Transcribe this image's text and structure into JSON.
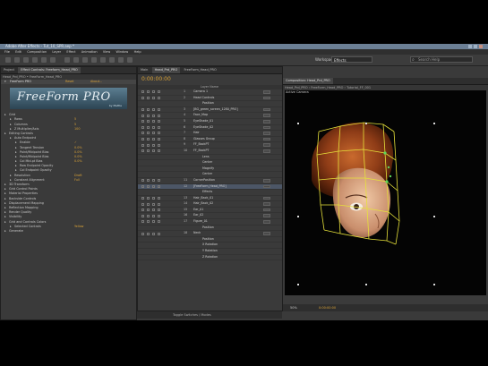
{
  "app": {
    "title": "Adobe After Effects - Tut_10_SPR.aep *",
    "menu": [
      "File",
      "Edit",
      "Composition",
      "Layer",
      "Effect",
      "Animation",
      "View",
      "Window",
      "Help"
    ],
    "workspace_label": "Workspace:",
    "workspace_value": "Effects",
    "search_placeholder": "Search Help"
  },
  "effect_controls": {
    "tabs": [
      "Project",
      "Effect Controls: Freeform_Head_PRO"
    ],
    "subtitle": "Head_Prd_PRO • FreeForm_Head_PRO",
    "effect_name": "FreeForm PRO",
    "effect_reset": "Reset",
    "effect_about": "About...",
    "logo_text": "FreeForm PRO",
    "logo_sub": "by Mettle",
    "params": [
      {
        "label": "Grid",
        "value": ""
      },
      {
        "label": "Rows",
        "value": "5"
      },
      {
        "label": "Columns",
        "value": "5"
      },
      {
        "label": "Z Multiplier/Axis",
        "value": "100"
      },
      {
        "label": "Editing Controls",
        "value": ""
      },
      {
        "label": "Auto Endpoint",
        "value": ""
      },
      {
        "label": "Enable",
        "value": "✓"
      },
      {
        "label": "Tangent Tension",
        "value": "0.0%"
      },
      {
        "label": "Point/Midpoint Bias",
        "value": "0.0%"
      },
      {
        "label": "Point/Midpoint Bias",
        "value": "0.0%"
      },
      {
        "label": "Col Mid-pt Bias",
        "value": "0.0%"
      },
      {
        "label": "Row Endpoint Opacity",
        "value": ""
      },
      {
        "label": "Col Endpoint Opacity",
        "value": ""
      },
      {
        "label": "Resolution",
        "value": "Draft"
      },
      {
        "label": "Constant Alignment",
        "value": "Full"
      },
      {
        "label": "3D Transform",
        "value": ""
      },
      {
        "label": "Grid Control Points",
        "value": ""
      },
      {
        "label": "Material Properties",
        "value": ""
      },
      {
        "label": "Backside Controls",
        "value": ""
      },
      {
        "label": "Displacement Mapping",
        "value": ""
      },
      {
        "label": "Reflection Mapping",
        "value": ""
      },
      {
        "label": "Render Quality",
        "value": ""
      },
      {
        "label": "Visibility",
        "value": ""
      },
      {
        "label": "Grid and Controls Colors",
        "value": ""
      },
      {
        "label": "Selected Controls",
        "value": "Yellow"
      },
      {
        "label": "Generate",
        "value": ""
      }
    ]
  },
  "timeline": {
    "tabs": [
      "Main",
      "Head_Prd_PRO",
      "FreeForm_Head_PRO"
    ],
    "timecode": "0:00:00:00",
    "column_header": "Layer Name",
    "layers": [
      {
        "num": "1",
        "name": "Camera 1"
      },
      {
        "num": "2",
        "name": "Head Controls"
      },
      {
        "num": "",
        "name": "Position"
      },
      {
        "num": "3",
        "name": "[BG_green_screen_1280_PRO]"
      },
      {
        "num": "4",
        "name": "Face_Map"
      },
      {
        "num": "5",
        "name": "EyeShade_01"
      },
      {
        "num": "6",
        "name": "EyeShade_02"
      },
      {
        "num": "7",
        "name": "Hair"
      },
      {
        "num": "8",
        "name": "Glasses Group"
      },
      {
        "num": "9",
        "name": "FF_BackPT"
      },
      {
        "num": "10",
        "name": "FF_BackPT"
      },
      {
        "num": "",
        "name": "Lens"
      },
      {
        "num": "",
        "name": "Center"
      },
      {
        "num": "",
        "name": "Magnify"
      },
      {
        "num": "",
        "name": "Center"
      },
      {
        "num": "11",
        "name": "CornerPosition"
      },
      {
        "num": "12",
        "name": "[FreeForm_Head_PRO]"
      },
      {
        "num": "",
        "name": "Effects"
      },
      {
        "num": "13",
        "name": "Hair_Back_01"
      },
      {
        "num": "14",
        "name": "Hair_Back_02"
      },
      {
        "num": "15",
        "name": "Ear_01"
      },
      {
        "num": "16",
        "name": "Ear_02"
      },
      {
        "num": "17",
        "name": "Figure_01"
      },
      {
        "num": "",
        "name": "Position"
      },
      {
        "num": "18",
        "name": "Neck"
      },
      {
        "num": "",
        "name": "Position"
      },
      {
        "num": "",
        "name": "X Rotation"
      },
      {
        "num": "",
        "name": "Y Rotation"
      },
      {
        "num": "",
        "name": "Z Rotation"
      }
    ],
    "mode_value": "Normal",
    "footer": "Toggle Switches / Modes"
  },
  "composition": {
    "tabs": [
      "Composition: Head_Prd_PRO"
    ],
    "breadcrumb": [
      "Head_Prd_PRO",
      "FreeForm_Head_PRO",
      "Tutorial_FF_001"
    ],
    "view_label": "Active Camera",
    "zoom": "50%",
    "footer_timecode": "0:00:00:00"
  },
  "colors": {
    "accent": "#d9a237",
    "selected_row": "#4c5666",
    "grid": "#e6e13a"
  }
}
